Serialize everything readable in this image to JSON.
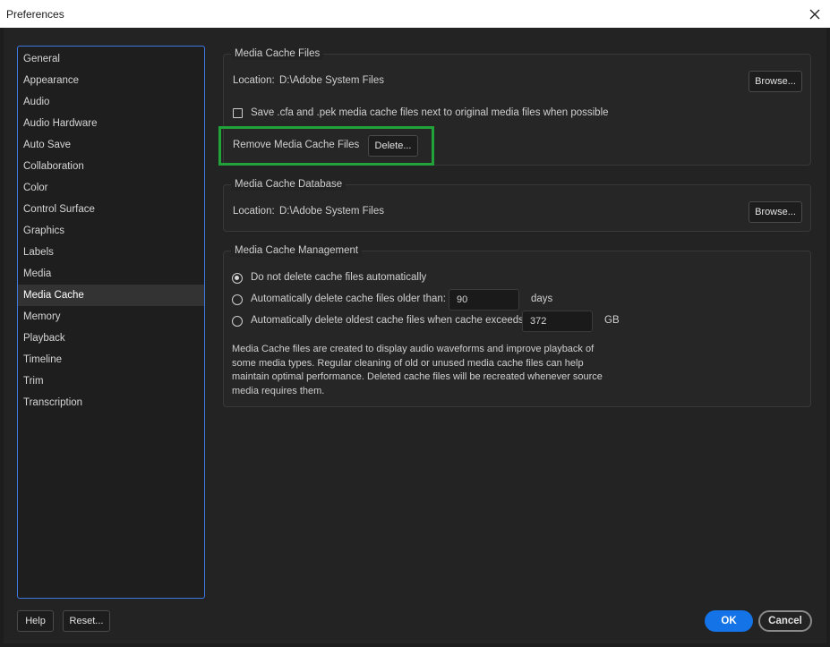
{
  "window": {
    "title": "Preferences"
  },
  "sidebar": {
    "items": [
      {
        "label": "General"
      },
      {
        "label": "Appearance"
      },
      {
        "label": "Audio"
      },
      {
        "label": "Audio Hardware"
      },
      {
        "label": "Auto Save"
      },
      {
        "label": "Collaboration"
      },
      {
        "label": "Color"
      },
      {
        "label": "Control Surface"
      },
      {
        "label": "Graphics"
      },
      {
        "label": "Labels"
      },
      {
        "label": "Media"
      },
      {
        "label": "Media Cache",
        "selected": true
      },
      {
        "label": "Memory"
      },
      {
        "label": "Playback"
      },
      {
        "label": "Timeline"
      },
      {
        "label": "Trim"
      },
      {
        "label": "Transcription"
      }
    ]
  },
  "media_cache_files": {
    "title": "Media Cache Files",
    "location_label": "Location:",
    "location_value": "D:\\Adobe System Files",
    "browse_label": "Browse...",
    "save_option_label": "Save .cfa and .pek media cache files next to original media files when possible",
    "save_option_checked": false,
    "remove_label": "Remove Media Cache Files",
    "delete_label": "Delete..."
  },
  "media_cache_database": {
    "title": "Media Cache Database",
    "location_label": "Location:",
    "location_value": "D:\\Adobe System Files",
    "browse_label": "Browse..."
  },
  "media_cache_management": {
    "title": "Media Cache Management",
    "option_no_delete": "Do not delete cache files automatically",
    "option_older_than": "Automatically delete cache files older than:",
    "older_than_value": "90",
    "older_than_unit": "days",
    "option_exceeds": "Automatically delete oldest cache files when cache exceeds:",
    "exceeds_value": "372",
    "exceeds_unit": "GB",
    "selected_option": "no_delete",
    "description": "Media Cache files are created to display audio waveforms and improve playback of some media types.  Regular cleaning of old or unused media cache files can help maintain optimal performance. Deleted cache files will be recreated whenever source media requires them."
  },
  "footer": {
    "help_label": "Help",
    "reset_label": "Reset...",
    "ok_label": "OK",
    "cancel_label": "Cancel"
  },
  "colors": {
    "accent": "#1473e6",
    "highlight": "#22a33a",
    "sidebar_border": "#3c7ae0"
  },
  "icons": {
    "close": "close-icon"
  }
}
